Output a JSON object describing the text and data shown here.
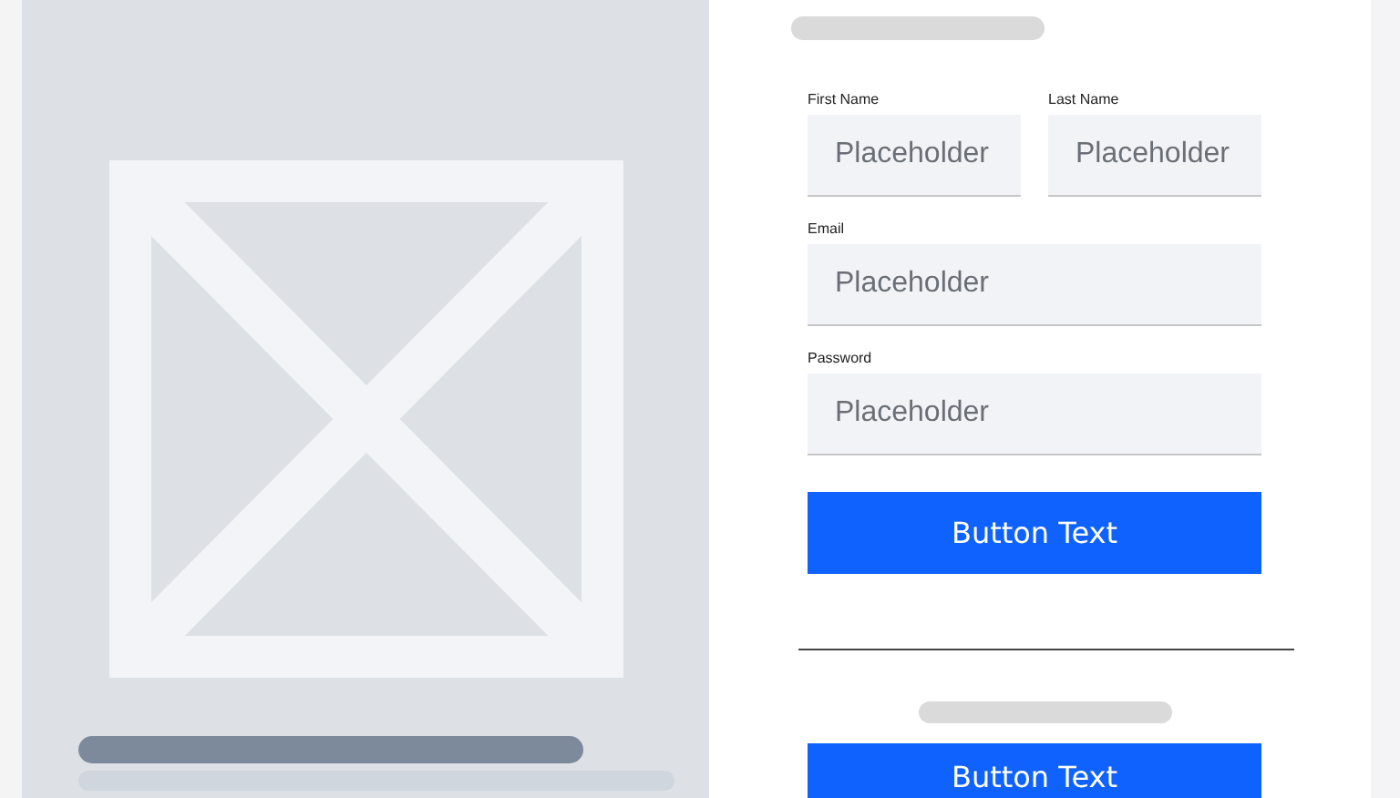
{
  "form": {
    "rows": [
      [
        {
          "label": "First Name",
          "placeholder": "Placeholder"
        },
        {
          "label": "Last Name",
          "placeholder": "Placeholder"
        }
      ],
      [
        {
          "label": "Email",
          "placeholder": "Placeholder"
        }
      ],
      [
        {
          "label": "Password",
          "placeholder": "Placeholder"
        }
      ]
    ],
    "submit_button": "Button Text"
  },
  "second_button": "Button Text"
}
